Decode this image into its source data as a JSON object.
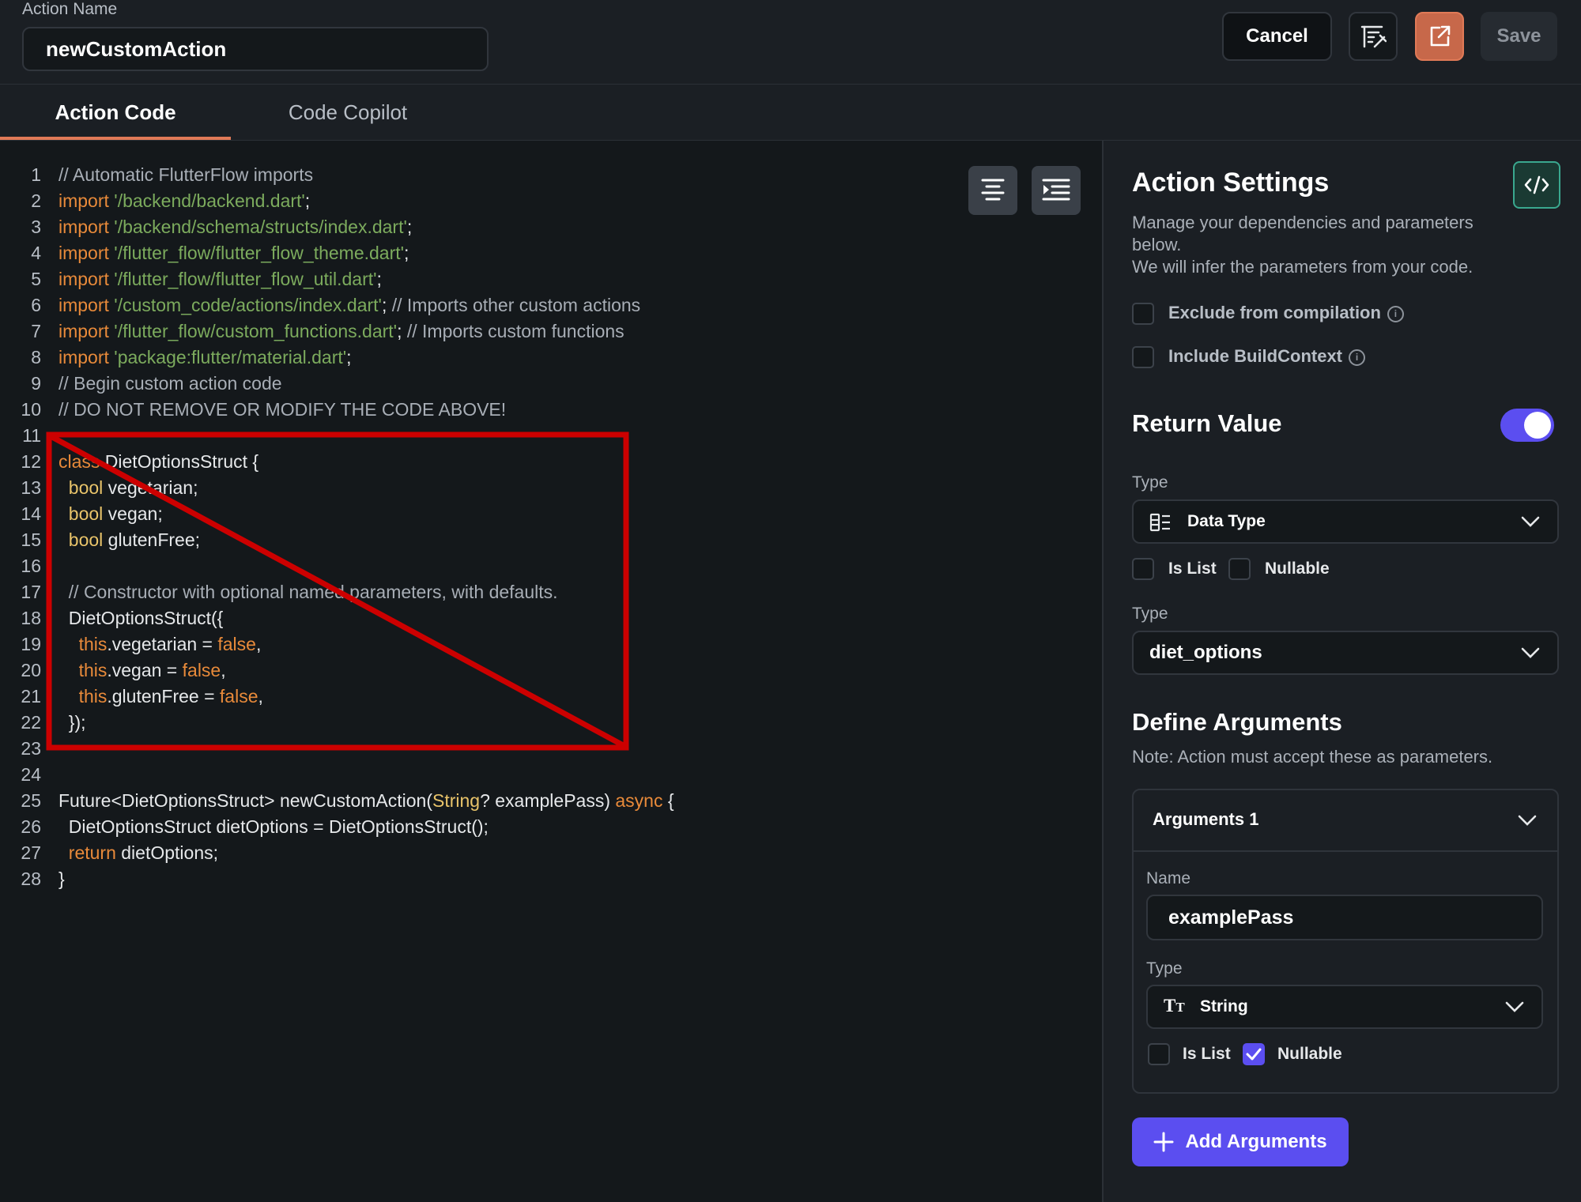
{
  "header": {
    "name_label": "Action Name",
    "name_value": "newCustomAction",
    "cancel_label": "Cancel",
    "save_label": "Save"
  },
  "tabs": [
    {
      "label": "Action Code",
      "active": true
    },
    {
      "label": "Code Copilot",
      "active": false
    }
  ],
  "code_lines": [
    [
      [
        "c-comment",
        "// Automatic FlutterFlow imports"
      ]
    ],
    [
      [
        "c-kw",
        "import"
      ],
      [
        "c-plain",
        " "
      ],
      [
        "c-str",
        "'/backend/backend.dart'"
      ],
      [
        "c-plain",
        ";"
      ]
    ],
    [
      [
        "c-kw",
        "import"
      ],
      [
        "c-plain",
        " "
      ],
      [
        "c-str",
        "'/backend/schema/structs/index.dart'"
      ],
      [
        "c-plain",
        ";"
      ]
    ],
    [
      [
        "c-kw",
        "import"
      ],
      [
        "c-plain",
        " "
      ],
      [
        "c-str",
        "'/flutter_flow/flutter_flow_theme.dart'"
      ],
      [
        "c-plain",
        ";"
      ]
    ],
    [
      [
        "c-kw",
        "import"
      ],
      [
        "c-plain",
        " "
      ],
      [
        "c-str",
        "'/flutter_flow/flutter_flow_util.dart'"
      ],
      [
        "c-plain",
        ";"
      ]
    ],
    [
      [
        "c-kw",
        "import"
      ],
      [
        "c-plain",
        " "
      ],
      [
        "c-str",
        "'/custom_code/actions/index.dart'"
      ],
      [
        "c-plain",
        "; "
      ],
      [
        "c-comment",
        "// Imports other custom actions"
      ]
    ],
    [
      [
        "c-kw",
        "import"
      ],
      [
        "c-plain",
        " "
      ],
      [
        "c-str",
        "'/flutter_flow/custom_functions.dart'"
      ],
      [
        "c-plain",
        "; "
      ],
      [
        "c-comment",
        "// Imports custom functions"
      ]
    ],
    [
      [
        "c-kw",
        "import"
      ],
      [
        "c-plain",
        " "
      ],
      [
        "c-str",
        "'package:flutter/material.dart'"
      ],
      [
        "c-plain",
        ";"
      ]
    ],
    [
      [
        "c-comment",
        "// Begin custom action code"
      ]
    ],
    [
      [
        "c-comment",
        "// DO NOT REMOVE OR MODIFY THE CODE ABOVE!"
      ]
    ],
    [
      [
        "c-plain",
        ""
      ]
    ],
    [
      [
        "c-kw",
        "class"
      ],
      [
        "c-plain",
        " DietOptionsStruct {"
      ]
    ],
    [
      [
        "c-plain",
        "  "
      ],
      [
        "c-type",
        "bool"
      ],
      [
        "c-plain",
        " vegetarian;"
      ]
    ],
    [
      [
        "c-plain",
        "  "
      ],
      [
        "c-type",
        "bool"
      ],
      [
        "c-plain",
        " vegan;"
      ]
    ],
    [
      [
        "c-plain",
        "  "
      ],
      [
        "c-type",
        "bool"
      ],
      [
        "c-plain",
        " glutenFree;"
      ]
    ],
    [
      [
        "c-plain",
        ""
      ]
    ],
    [
      [
        "c-plain",
        "  "
      ],
      [
        "c-comment",
        "// Constructor with optional named parameters, with defaults."
      ]
    ],
    [
      [
        "c-plain",
        "  DietOptionsStruct({"
      ]
    ],
    [
      [
        "c-plain",
        "    "
      ],
      [
        "c-kw",
        "this"
      ],
      [
        "c-plain",
        ".vegetarian = "
      ],
      [
        "c-kw",
        "false"
      ],
      [
        "c-plain",
        ","
      ]
    ],
    [
      [
        "c-plain",
        "    "
      ],
      [
        "c-kw",
        "this"
      ],
      [
        "c-plain",
        ".vegan = "
      ],
      [
        "c-kw",
        "false"
      ],
      [
        "c-plain",
        ","
      ]
    ],
    [
      [
        "c-plain",
        "    "
      ],
      [
        "c-kw",
        "this"
      ],
      [
        "c-plain",
        ".glutenFree = "
      ],
      [
        "c-kw",
        "false"
      ],
      [
        "c-plain",
        ","
      ]
    ],
    [
      [
        "c-plain",
        "  });"
      ]
    ],
    [
      [
        "c-plain",
        ""
      ]
    ],
    [
      [
        "c-plain",
        ""
      ]
    ],
    [
      [
        "c-plain",
        "Future<DietOptionsStruct> newCustomAction("
      ],
      [
        "c-type",
        "String"
      ],
      [
        "c-plain",
        "? examplePass) "
      ],
      [
        "c-kw",
        "async"
      ],
      [
        "c-plain",
        " {"
      ]
    ],
    [
      [
        "c-plain",
        "  DietOptionsStruct dietOptions = DietOptionsStruct();"
      ]
    ],
    [
      [
        "c-plain",
        "  "
      ],
      [
        "c-kw",
        "return"
      ],
      [
        "c-plain",
        " dietOptions;"
      ]
    ],
    [
      [
        "c-plain",
        "}"
      ]
    ]
  ],
  "settings": {
    "title": "Action Settings",
    "desc1": "Manage your dependencies and parameters",
    "desc2": "below.",
    "desc3": "We will infer the parameters from your code.",
    "exclude_label": "Exclude from compilation",
    "include_ctx_label": "Include BuildContext",
    "return_title": "Return Value",
    "return_enabled": true,
    "type_label_1": "Type",
    "type_value_1": "Data Type",
    "is_list_label": "Is List",
    "nullable_label": "Nullable",
    "type_label_2": "Type",
    "type_value_2": "diet_options",
    "args_title": "Define Arguments",
    "args_note": "Note: Action must accept these as parameters.",
    "arg_card_title": "Arguments 1",
    "arg_name_label": "Name",
    "arg_name_value": "examplePass",
    "arg_type_label": "Type",
    "arg_type_value": "String",
    "arg_is_list_label": "Is List",
    "arg_nullable_label": "Nullable",
    "arg_nullable_checked": true,
    "add_args_label": "Add Arguments"
  },
  "colors": {
    "accent": "#5b4ef0",
    "orange": "#e07a57",
    "annotation_red": "#cc0000",
    "teal": "#3aa88f"
  }
}
